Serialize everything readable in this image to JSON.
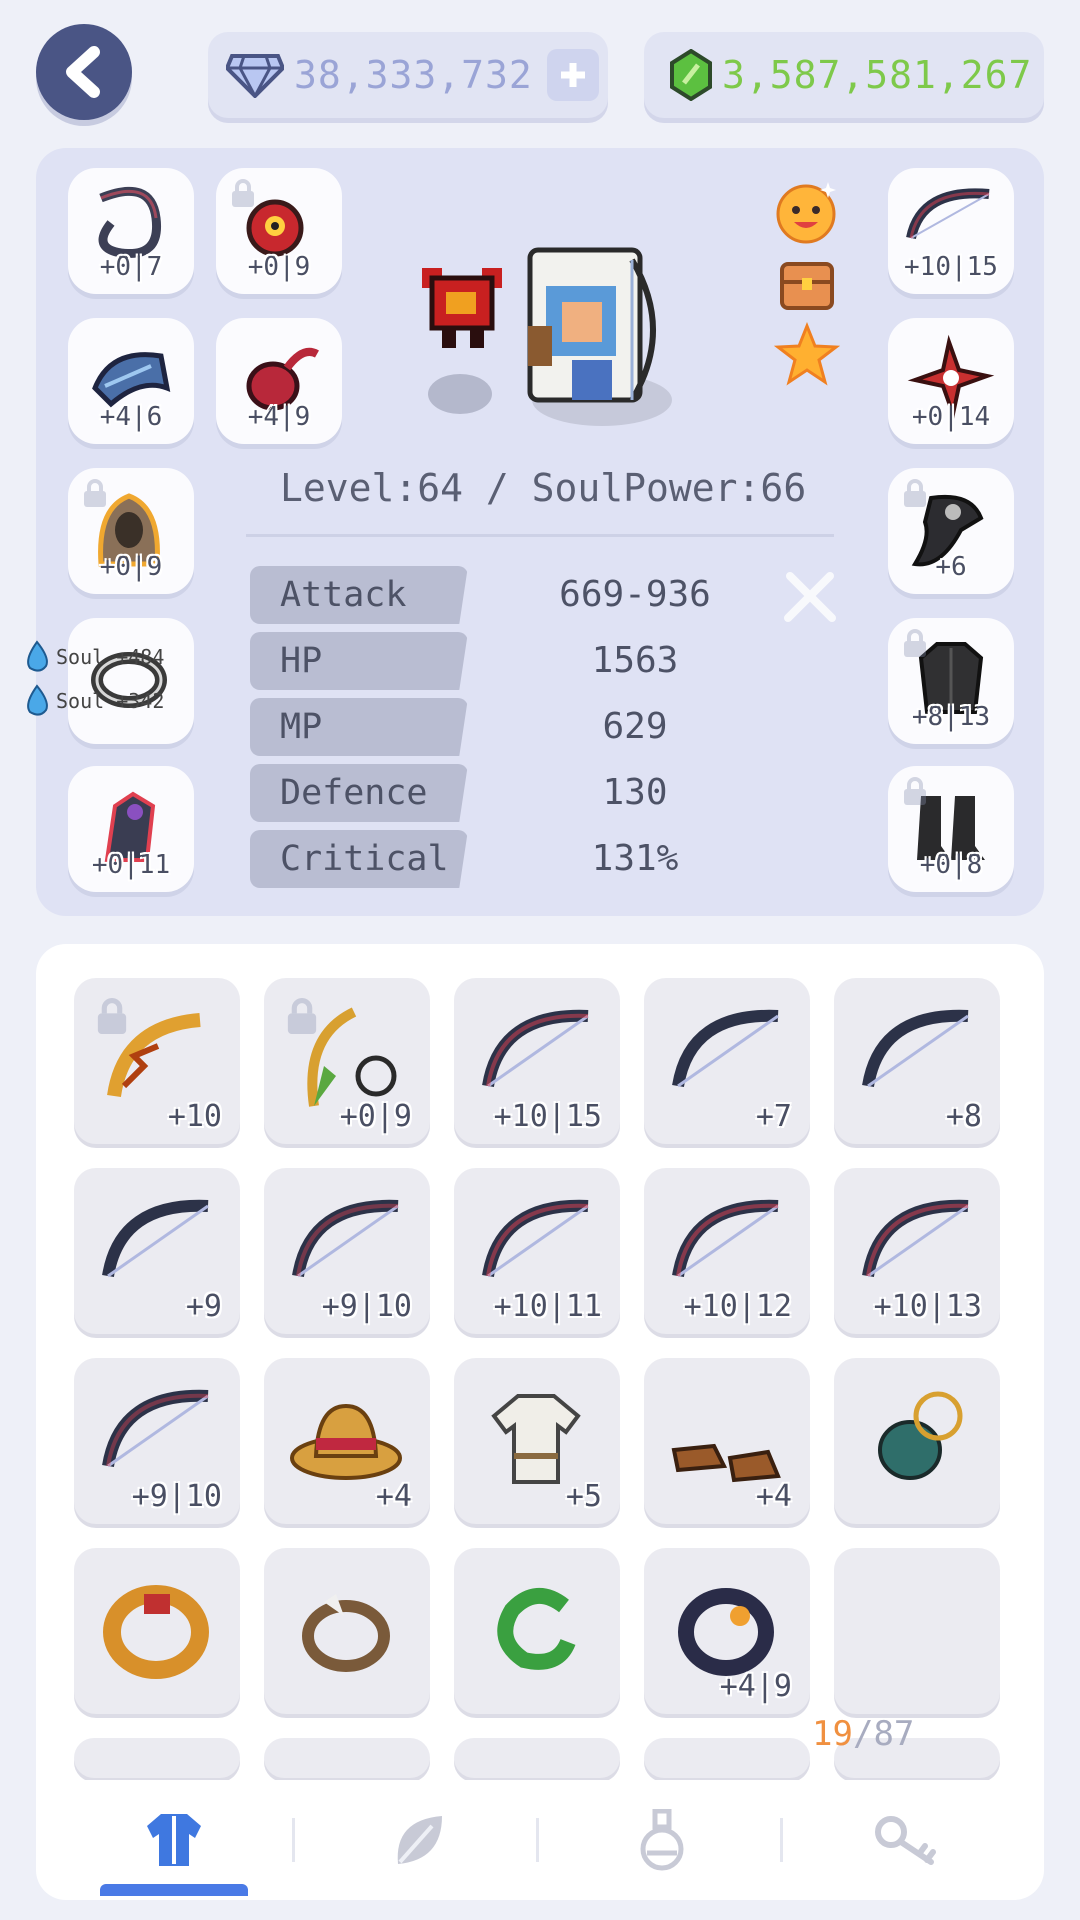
{
  "currency": {
    "gems": "38,333,732",
    "green_gems": "3,587,581,267"
  },
  "character": {
    "level_text": "Level:64 / SoulPower:66",
    "stats": [
      {
        "label": "Attack",
        "value": "669-936"
      },
      {
        "label": "HP",
        "value": "1563"
      },
      {
        "label": "MP",
        "value": "629"
      },
      {
        "label": "Defence",
        "value": "130"
      },
      {
        "label": "Critical",
        "value": "131%"
      }
    ],
    "souls": [
      "Soul +484",
      "Soul +342"
    ]
  },
  "equip_left": [
    {
      "label": "+0|7",
      "icon": "rope-icon",
      "color": "#3c3f55"
    },
    {
      "label": "+0|9",
      "icon": "red-eye-amulet-icon",
      "color": "#c8282e"
    },
    {
      "label": "+4|6",
      "icon": "chain-claw-icon",
      "color": "#4a6fa8"
    },
    {
      "label": "+4|9",
      "icon": "red-pouch-icon",
      "color": "#b8283a"
    },
    {
      "label": "+0|9",
      "icon": "hood-icon",
      "color": "#8a7058"
    },
    {
      "label": "",
      "icon": "ring-icon",
      "color": "#3a3a3a"
    },
    {
      "label": "+0|11",
      "icon": "dark-armor-icon",
      "color": "#3a3d52"
    }
  ],
  "equip_right": [
    {
      "label": "+10|15",
      "icon": "bow-icon",
      "color": "#2c3248"
    },
    {
      "label": "+0|14",
      "icon": "shuriken-icon",
      "color": "#c83030"
    },
    {
      "label": "+6",
      "icon": "plague-mask-icon",
      "color": "#2c2c30"
    },
    {
      "label": "+8|13",
      "icon": "dark-chest-icon",
      "color": "#303032"
    },
    {
      "label": "+0|8",
      "icon": "boots-icon",
      "color": "#2a2a2c"
    }
  ],
  "inventory": [
    {
      "label": "+10",
      "icon": "golden-bow-icon",
      "color": "#e0a030"
    },
    {
      "label": "+0|9",
      "icon": "leaf-bow-icon",
      "color": "#5aa840"
    },
    {
      "label": "+10|15",
      "icon": "bow-icon",
      "color": "#2c3248"
    },
    {
      "label": "+7",
      "icon": "bow-icon",
      "color": "#2c3248"
    },
    {
      "label": "+8",
      "icon": "bow-icon",
      "color": "#2c3248"
    },
    {
      "label": "+9",
      "icon": "bow-icon",
      "color": "#2c3248"
    },
    {
      "label": "+9|10",
      "icon": "bow-icon",
      "color": "#2c3248"
    },
    {
      "label": "+10|11",
      "icon": "bow-icon",
      "color": "#2c3248"
    },
    {
      "label": "+10|12",
      "icon": "bow-icon",
      "color": "#2c3248"
    },
    {
      "label": "+10|13",
      "icon": "bow-icon",
      "color": "#2c3248"
    },
    {
      "label": "+9|10",
      "icon": "bow-icon",
      "color": "#2c3248"
    },
    {
      "label": "+4",
      "icon": "straw-hat-icon",
      "color": "#d8a040"
    },
    {
      "label": "+5",
      "icon": "white-shirt-icon",
      "color": "#f0eee8"
    },
    {
      "label": "+4",
      "icon": "shoes-icon",
      "color": "#9a5a2a"
    },
    {
      "label": "",
      "icon": "teal-bag-icon",
      "color": "#2f6e6a"
    },
    {
      "label": "",
      "icon": "gold-ring-icon",
      "color": "#d8902a"
    },
    {
      "label": "",
      "icon": "bone-ring-icon",
      "color": "#7a5a3a"
    },
    {
      "label": "",
      "icon": "green-ring-icon",
      "color": "#3aa040"
    },
    {
      "label": "+4|9",
      "icon": "dark-ring-icon",
      "color": "#2a2c48"
    },
    {
      "label": "",
      "icon": "empty-slot",
      "color": ""
    }
  ],
  "inventory_count": {
    "current": "19",
    "separator": "/",
    "total": "87"
  },
  "tabs": [
    "equipment-tab",
    "leaf-tab",
    "potion-tab",
    "key-tab"
  ]
}
